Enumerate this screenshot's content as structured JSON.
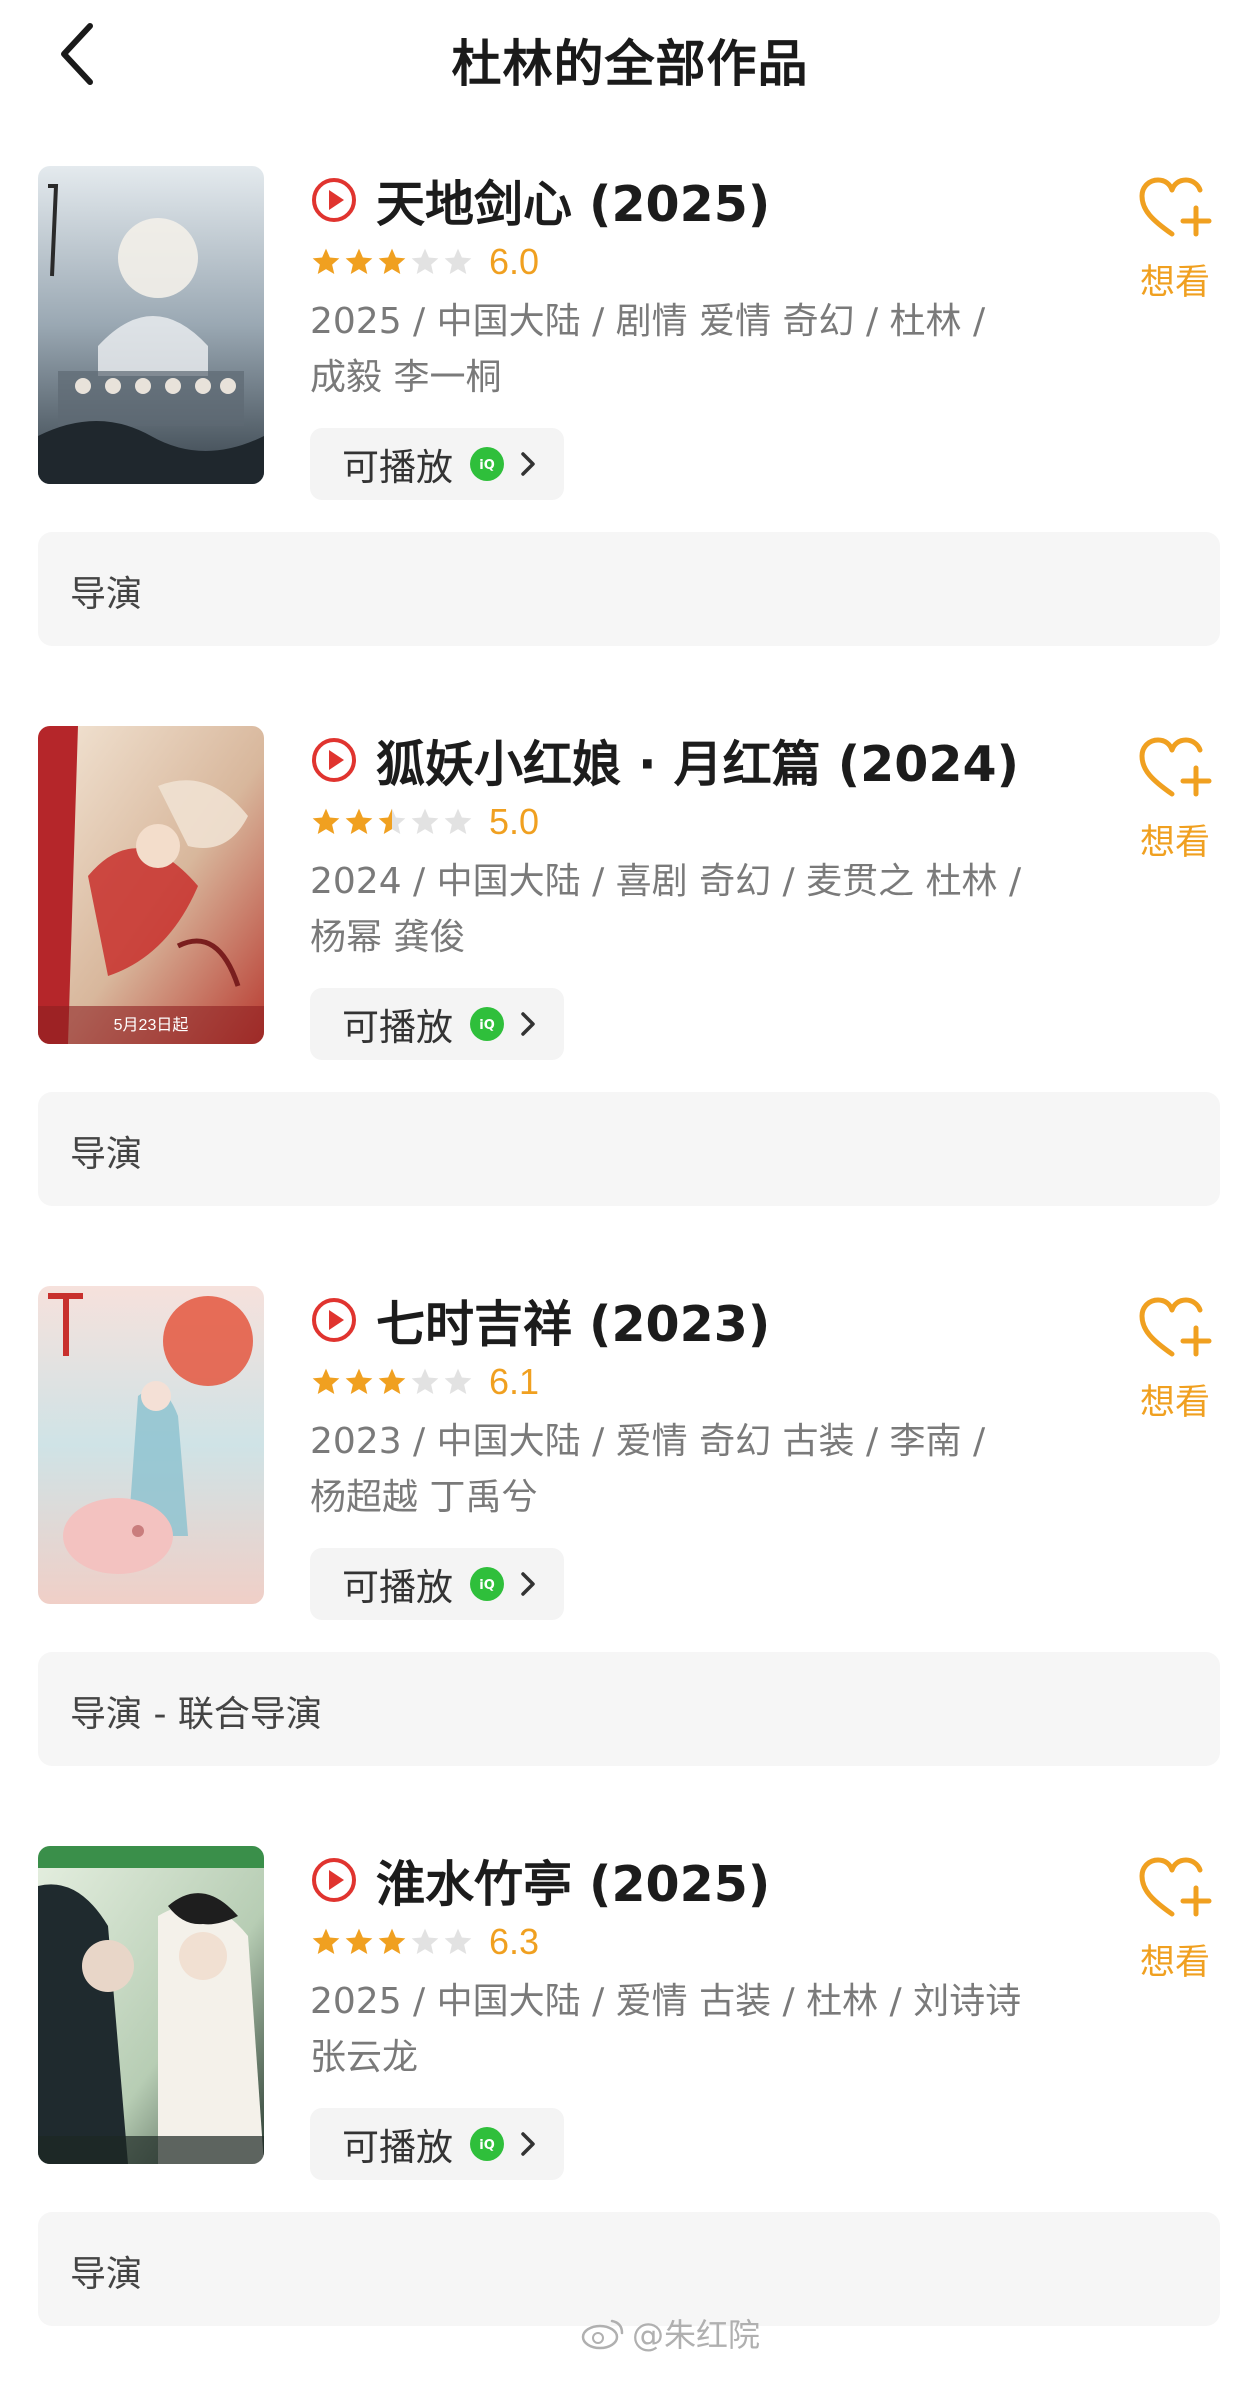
{
  "header": {
    "title": "杜林的全部作品",
    "back_icon": "chevron-left-icon"
  },
  "works": [
    {
      "title": "天地剑心 (2025)",
      "rating_stars": 3,
      "rating": "6.0",
      "info": "2025 / 中国大陆 / 剧情 爱情 奇幻 / 杜林 / 成毅 李一桐",
      "play_label": "可播放",
      "wish_label": "想看",
      "role": "导演",
      "poster_colors": [
        "#c9d3dc",
        "#7f8f9c",
        "#2f3a44"
      ]
    },
    {
      "title": "狐妖小红娘 · 月红篇 (2024)",
      "rating_stars": 2.5,
      "rating": "5.0",
      "info": "2024 / 中国大陆 / 喜剧 奇幻 / 麦贯之 杜林 / 杨幂 龚俊",
      "play_label": "可播放",
      "wish_label": "想看",
      "role": "导演",
      "poster_text": "5月23日起",
      "poster_colors": [
        "#f1e2d2",
        "#c83a34",
        "#8e1f22"
      ]
    },
    {
      "title": "七时吉祥 (2023)",
      "rating_stars": 3,
      "rating": "6.1",
      "info": "2023 / 中国大陆 / 爱情 奇幻 古装 / 李南 / 杨超越 丁禹兮",
      "play_label": "可播放",
      "wish_label": "想看",
      "role": "导演 - 联合导演",
      "poster_colors": [
        "#f4d9d2",
        "#9bcbd3",
        "#e26a5c"
      ]
    },
    {
      "title": "淮水竹亭 (2025)",
      "rating_stars": 3,
      "rating": "6.3",
      "info": "2025 / 中国大陆 / 爱情 古装 / 杜林 / 刘诗诗 张云龙",
      "play_label": "可播放",
      "wish_label": "想看",
      "role": "导演",
      "poster_colors": [
        "#d7e6d0",
        "#3f5a47",
        "#1d2b24"
      ]
    }
  ],
  "watermark": {
    "text": "@朱红院",
    "icon": "weibo-icon"
  },
  "colors": {
    "accent": "#f0a020",
    "play_red": "#e0342f",
    "iqiyi_green": "#2fbf3b"
  }
}
